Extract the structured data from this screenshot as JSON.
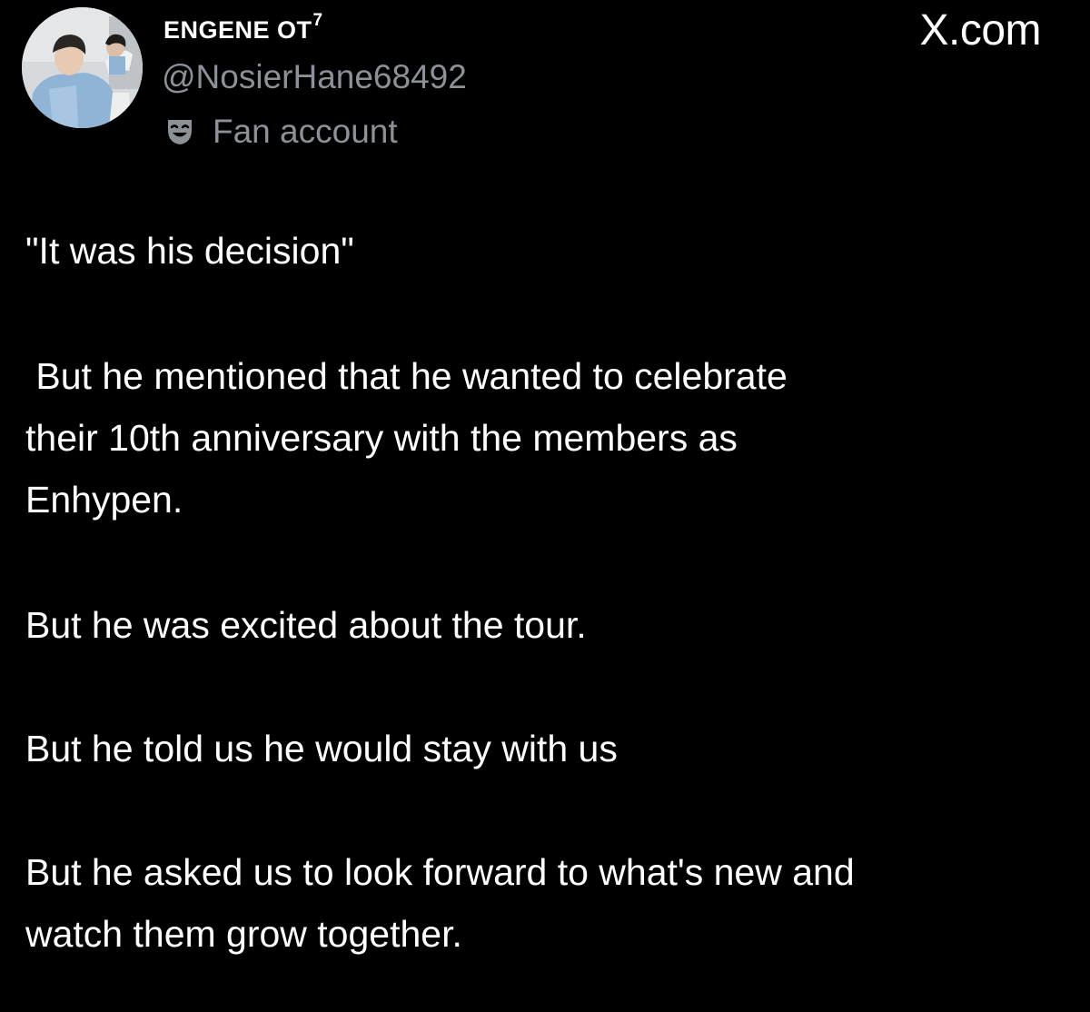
{
  "tweet": {
    "author": {
      "display_name": "ENGENE OT",
      "display_name_superscript": "7",
      "handle": "@NosierHane68492",
      "label": "Fan account",
      "label_icon": "theater-mask-icon",
      "avatar": "profile-photo"
    },
    "brand": "X.com",
    "paragraphs": [
      "\"It was his decision\"",
      " But he mentioned that he wanted to celebrate\ntheir 10th anniversary with the members as\nEnhypen.",
      "But he was excited about the tour.",
      "But he told us he would stay with us",
      "But he asked us to look forward to what's new and\nwatch them grow together."
    ]
  }
}
